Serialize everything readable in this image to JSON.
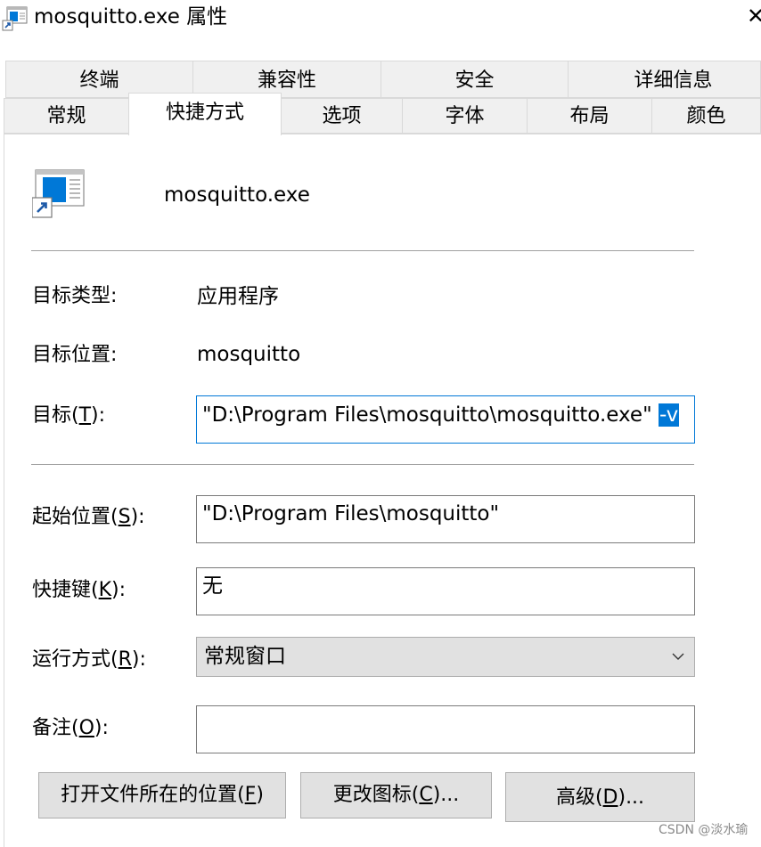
{
  "window": {
    "title": "mosquitto.exe 属性",
    "close_symbol": "✕",
    "icon": "shortcut-app-icon"
  },
  "tabs": {
    "row1": [
      "终端",
      "兼容性",
      "安全",
      "详细信息"
    ],
    "row2": [
      "常规",
      "快捷方式",
      "选项",
      "字体",
      "布局",
      "颜色"
    ],
    "active": "快捷方式"
  },
  "header": {
    "app_name": "mosquitto.exe",
    "icon": "application-shortcut-icon"
  },
  "fields": {
    "target_type": {
      "label": "目标类型:",
      "value": "应用程序"
    },
    "target_location": {
      "label": "目标位置:",
      "value": "mosquitto"
    },
    "target": {
      "label_pre": "目标(",
      "label_key": "T",
      "label_post": "):",
      "value_main": "\"D:\\Program Files\\mosquitto\\mosquitto.exe\" ",
      "value_selected": "-v"
    },
    "start_in": {
      "label_pre": "起始位置(",
      "label_key": "S",
      "label_post": "):",
      "value": "\"D:\\Program Files\\mosquitto\""
    },
    "shortcut_key": {
      "label_pre": "快捷键(",
      "label_key": "K",
      "label_post": "):",
      "value": "无"
    },
    "run": {
      "label_pre": "运行方式(",
      "label_key": "R",
      "label_post": "):",
      "value": "常规窗口"
    },
    "comment": {
      "label_pre": "备注(",
      "label_key": "O",
      "label_post": "):",
      "value": ""
    }
  },
  "buttons": {
    "open_location": {
      "pre": "打开文件所在的位置(",
      "key": "F",
      "post": ")"
    },
    "change_icon": {
      "pre": "更改图标(",
      "key": "C",
      "post": ")..."
    },
    "advanced": {
      "pre": "高级(",
      "key": "D",
      "post": ")..."
    }
  },
  "watermark": "CSDN @淡水瑜",
  "colors": {
    "accent": "#0078d7",
    "tab_bg": "#f0f0f0",
    "button_bg": "#e1e1e1"
  }
}
